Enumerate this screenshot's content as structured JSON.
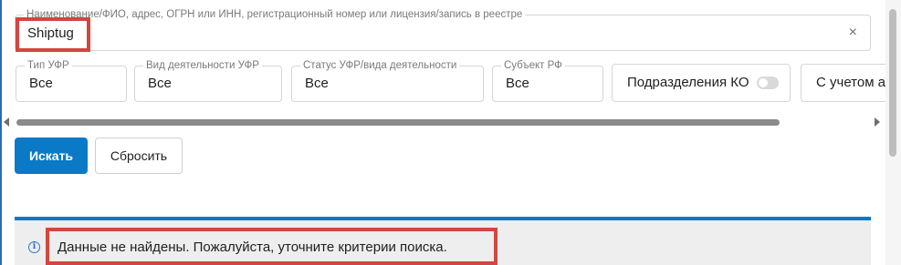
{
  "search": {
    "label": "Наименование/ФИО, адрес, ОГРН или ИНН, регистрационный номер или лицензия/запись в реестре",
    "value": "Shiptug",
    "clear_glyph": "×"
  },
  "filters": [
    {
      "label": "Тип УФР",
      "value": "Все"
    },
    {
      "label": "Вид деятельности УФР",
      "value": "Все"
    },
    {
      "label": "Статус УФР/вида деятельности",
      "value": "Все"
    },
    {
      "label": "Субъект РФ",
      "value": "Все"
    }
  ],
  "subdivisions_toggle": {
    "label": "Подразделения КО",
    "enabled": false
  },
  "truncated_option": {
    "label": "С учетом ад"
  },
  "buttons": {
    "search": "Искать",
    "reset": "Сбросить"
  },
  "alert": {
    "icon": "info-icon",
    "glyph": "i",
    "text": "Данные не найдены. Пожалуйста, уточните критерии поиска."
  },
  "colors": {
    "accent": "#0a7ac7",
    "highlight": "#d2473f",
    "alert_bg": "#eeeeee"
  }
}
